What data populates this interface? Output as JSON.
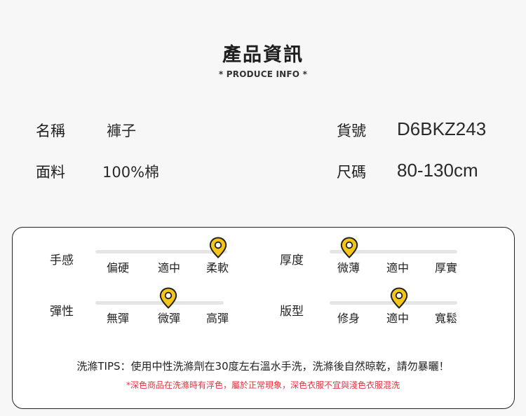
{
  "header": {
    "title": "產品資訊",
    "subtitle": "* PRODUCE INFO *"
  },
  "info": {
    "name_label": "名稱",
    "name_value": "褲子",
    "code_label": "貨號",
    "code_value": "D6BKZ243",
    "material_label": "面料",
    "material_value": "100%棉",
    "size_label": "尺碼",
    "size_value": "80-130cm"
  },
  "attributes": {
    "hand_feel": {
      "label": "手感",
      "options": [
        "偏硬",
        "適中",
        "柔軟"
      ],
      "selected": "柔軟"
    },
    "thickness": {
      "label": "厚度",
      "options": [
        "微薄",
        "適中",
        "厚實"
      ],
      "selected": "微薄"
    },
    "elasticity": {
      "label": "彈性",
      "options": [
        "無彈",
        "微彈",
        "高彈"
      ],
      "selected": "微彈"
    },
    "fit": {
      "label": "版型",
      "options": [
        "修身",
        "適中",
        "寬鬆"
      ],
      "selected": "適中"
    }
  },
  "care": {
    "tips": "洗滌TIPS：使用中性洗滌劑在30度左右溫水手洗，洗滌後自然晾乾，請勿暴曬！",
    "warning": "*深色商品在洗滌時有浮色，屬於正常現象，深色衣服不宜與淺色衣服混洗"
  },
  "colors": {
    "pin_fill": "#f5c518",
    "pin_stroke": "#222222",
    "track": "#e5e5e5",
    "warning_text": "#e0343f"
  },
  "icons": {
    "marker": "location-pin-icon"
  }
}
